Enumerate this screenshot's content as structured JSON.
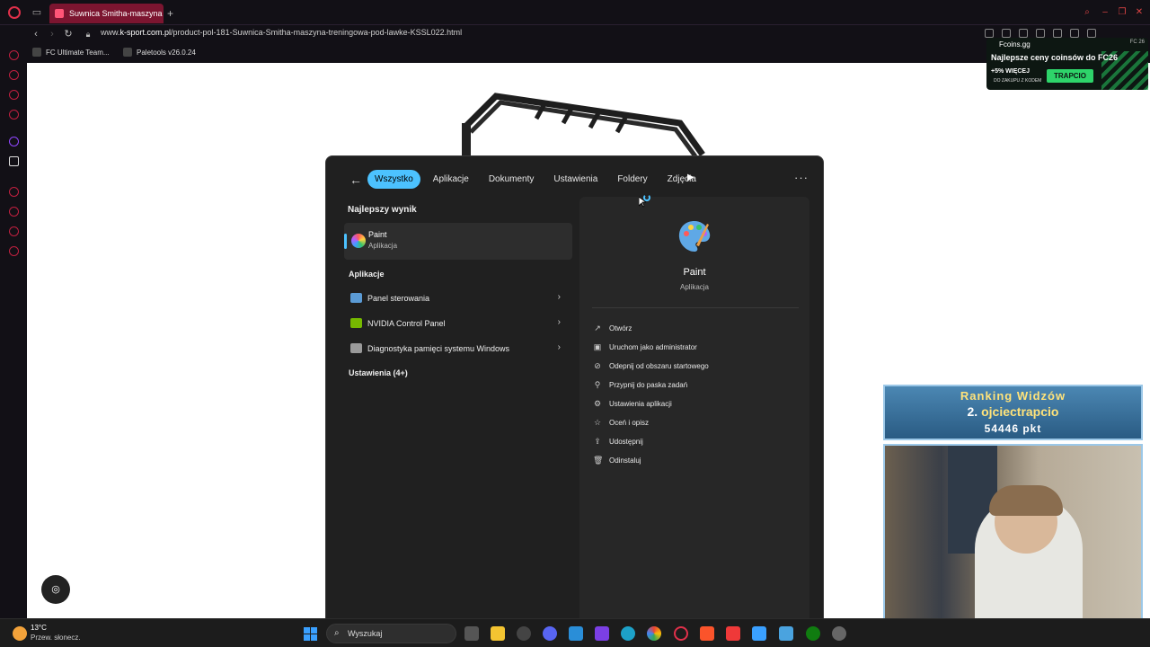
{
  "browser": {
    "tab_title": "Suwnica Smitha-maszyna",
    "new_tab": "+",
    "url_prefix": "www.",
    "url_host": "k-sport.com.pl",
    "url_path": "/product-pol-181-Suwnica-Smitha-maszyna-treningowa-pod-lawke-KSSL022.html",
    "bookmarks": [
      "FC Ultimate Team...",
      "Paletools v26.0.24"
    ]
  },
  "ad": {
    "brand": "Fcoins.gg",
    "badge": "FC 26",
    "headline": "Najlepsze ceny coinsów do FC26",
    "promo": "+5% WIĘCEJ",
    "promo_sub": "DO ZAKUPU Z KODEM",
    "cta": "TRAPCIO"
  },
  "search": {
    "filters": [
      "Wszystko",
      "Aplikacje",
      "Dokumenty",
      "Ustawienia",
      "Foldery",
      "Zdjęcia"
    ],
    "active_filter": "Wszystko",
    "best_heading": "Najlepszy wynik",
    "best": {
      "title": "Paint",
      "subtitle": "Aplikacja"
    },
    "apps_heading": "Aplikacje",
    "apps": [
      {
        "label": "Panel sterowania",
        "color": "#5b9bd5"
      },
      {
        "label": "NVIDIA Control Panel",
        "color": "#76b900"
      },
      {
        "label": "Diagnostyka pamięci systemu Windows",
        "color": "#9a9a9a"
      }
    ],
    "settings_heading": "Ustawienia (4+)",
    "preview": {
      "title": "Paint",
      "subtitle": "Aplikacja",
      "actions": [
        {
          "label": "Otwórz",
          "icon": "open-external-icon"
        },
        {
          "label": "Uruchom jako administrator",
          "icon": "admin-shield-icon"
        },
        {
          "label": "Odepnij od obszaru startowego",
          "icon": "unpin-icon"
        },
        {
          "label": "Przypnij do paska zadań",
          "icon": "pin-icon"
        },
        {
          "label": "Ustawienia aplikacji",
          "icon": "gear-icon"
        },
        {
          "label": "Oceń i opisz",
          "icon": "star-icon"
        },
        {
          "label": "Udostępnij",
          "icon": "share-icon"
        },
        {
          "label": "Odinstaluj",
          "icon": "trash-icon"
        }
      ]
    }
  },
  "overlay": {
    "ranking_title": "Ranking Widzów",
    "rank_position": "2.",
    "rank_name": "ojciectrapcio",
    "rank_points": "54446 pkt"
  },
  "taskbar": {
    "temperature": "13°C",
    "weather": "Przew. słonecz.",
    "search_placeholder": "Wyszukaj"
  },
  "colors": {
    "accent": "#4cc2ff",
    "opera_red": "#e0304a"
  }
}
